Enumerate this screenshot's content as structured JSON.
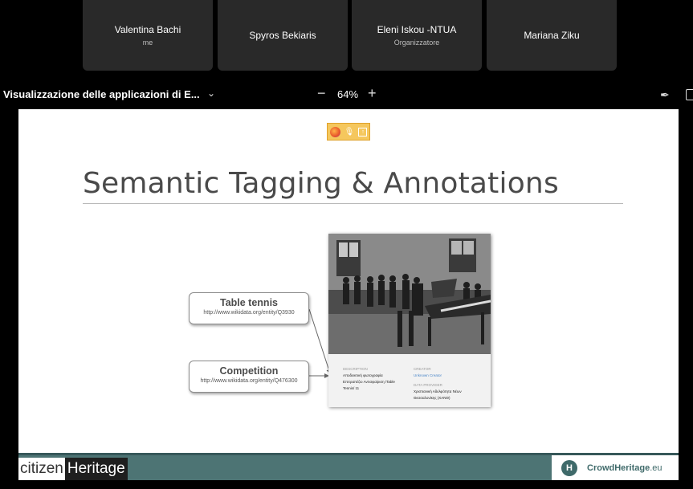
{
  "participants": [
    {
      "name": "Valentina Bachi",
      "role": "me"
    },
    {
      "name": "Spyros Bekiaris",
      "role": ""
    },
    {
      "name": "Eleni Iskou -NTUA",
      "role": "Organizzatore"
    },
    {
      "name": "Mariana Ziku",
      "role": ""
    }
  ],
  "share_bar": {
    "title": "Visualizzazione delle applicazioni di E...",
    "zoom_minus": "−",
    "zoom_level": "64%",
    "zoom_plus": "+"
  },
  "slide": {
    "title": "Semantic Tagging & Annotations",
    "callouts": [
      {
        "title": "Table tennis",
        "url": "http://www.wikidata.org/entity/Q3930"
      },
      {
        "title": "Competition",
        "url": "http://www.wikidata.org/entity/Q476300"
      }
    ],
    "card": {
      "description_label": "DESCRIPTION",
      "description_lines": [
        "Αποδεικτική φωτογραφία",
        "Επιτραπέζιο Αντισφαίριση /Table",
        "Tennis/ 11"
      ],
      "creator_label": "CREATOR",
      "creator_value": "Unknown Creator",
      "provider_label": "DATA PROVIDER",
      "provider_lines": [
        "Χριστιανική Αδελφότητα Νέων",
        "Θεσσαλονίκης (ΧΑΝΘ)"
      ]
    },
    "footer_left_a": "citizen",
    "footer_left_b": "Heritage",
    "footer_right_mark": "H",
    "footer_right_a": "CrowdHeritage",
    "footer_right_b": ".eu"
  }
}
